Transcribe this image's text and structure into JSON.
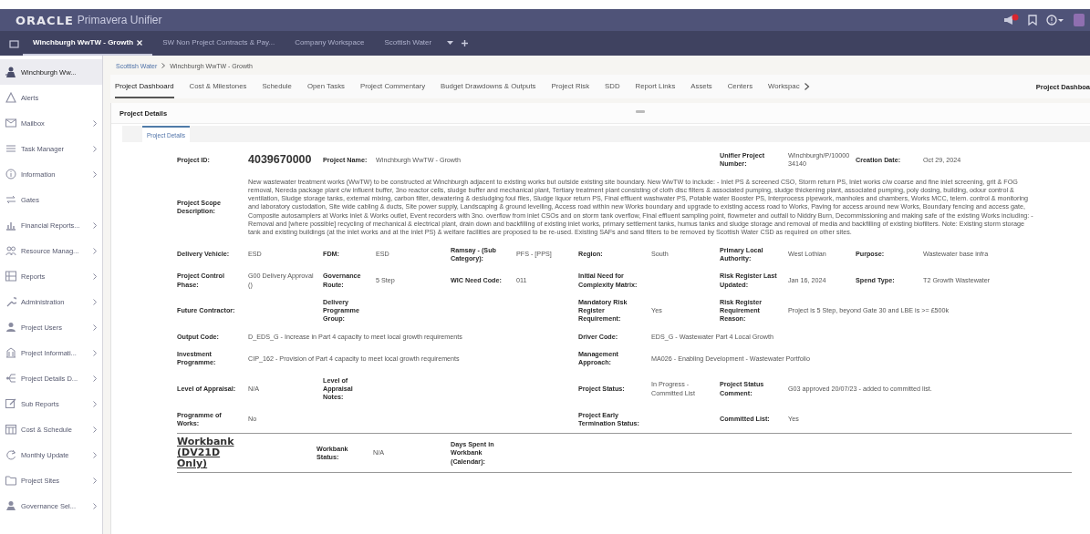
{
  "app": {
    "brand": "ORACLE",
    "product": "Primavera Unifier"
  },
  "top_tabs": [
    {
      "label": "Winchburgh WwTW - Growth",
      "selected": true,
      "closable": true
    },
    {
      "label": "SW Non Project Contracts & Pay...",
      "selected": false,
      "closable": false
    },
    {
      "label": "Company Workspace",
      "selected": false,
      "closable": false
    },
    {
      "label": "Scottish Water",
      "selected": false,
      "closable": false
    }
  ],
  "sidebar": {
    "items": [
      {
        "label": "Winchburgh Ww...",
        "selected": true,
        "has_submenu": false
      },
      {
        "label": "Alerts",
        "selected": false,
        "has_submenu": false
      },
      {
        "label": "Mailbox",
        "selected": false,
        "has_submenu": true
      },
      {
        "label": "Task Manager",
        "selected": false,
        "has_submenu": true
      },
      {
        "label": "Information",
        "selected": false,
        "has_submenu": true
      },
      {
        "label": "Gates",
        "selected": false,
        "has_submenu": false
      },
      {
        "label": "Financial Reports...",
        "selected": false,
        "has_submenu": true
      },
      {
        "label": "Resource Manag...",
        "selected": false,
        "has_submenu": true
      },
      {
        "label": "Reports",
        "selected": false,
        "has_submenu": true
      },
      {
        "label": "Administration",
        "selected": false,
        "has_submenu": true
      },
      {
        "label": "Project Users",
        "selected": false,
        "has_submenu": true
      },
      {
        "label": "Project Informati...",
        "selected": false,
        "has_submenu": true
      },
      {
        "label": "Project Details D...",
        "selected": false,
        "has_submenu": true
      },
      {
        "label": "Sub Reports",
        "selected": false,
        "has_submenu": true
      },
      {
        "label": "Cost & Schedule",
        "selected": false,
        "has_submenu": true
      },
      {
        "label": "Monthly Update",
        "selected": false,
        "has_submenu": true
      },
      {
        "label": "Project Sites",
        "selected": false,
        "has_submenu": true
      },
      {
        "label": "Governance Sel...",
        "selected": false,
        "has_submenu": true
      }
    ]
  },
  "breadcrumb": [
    "Scottish Water",
    "Winchburgh WwTW - Growth"
  ],
  "dashboard_tabs": [
    {
      "label": "Project Dashboard",
      "selected": true
    },
    {
      "label": "Cost & Milestones",
      "selected": false
    },
    {
      "label": "Schedule",
      "selected": false
    },
    {
      "label": "Open Tasks",
      "selected": false
    },
    {
      "label": "Project Commentary",
      "selected": false
    },
    {
      "label": "Budget Drawdowns & Outputs",
      "selected": false
    },
    {
      "label": "Project Risk",
      "selected": false
    },
    {
      "label": "SDD",
      "selected": false
    },
    {
      "label": "Report Links",
      "selected": false
    },
    {
      "label": "Assets",
      "selected": false
    },
    {
      "label": "Centers",
      "selected": false
    },
    {
      "label": "Workspac",
      "selected": false
    }
  ],
  "dashboard_title": "Project Dashboa",
  "panel": {
    "title": "Project Details",
    "tabs": [
      {
        "label": "Project Details",
        "selected": true
      }
    ],
    "rows": [
      {
        "fields": [
          {
            "label": "Project ID:",
            "value": "4039670000",
            "kind": "id"
          },
          {
            "label": "Project Name:",
            "value": "Winchburgh WwTW - Growth"
          },
          {
            "label": "Unifier Project Number:",
            "value": "Winchburgh/P/1000034140"
          },
          {
            "label": "Creation Date:",
            "value": "Oct 29, 2024"
          }
        ]
      },
      {
        "fields": [
          {
            "label": "Project Scope Description:",
            "value": "New wastewater treatment works (WwTW) to be constructed at Winchburgh adjacent to existing works but outside existing site boundary. New WwTW to include: - Inlet PS & screened CSO, Storm return PS, Inlet works c/w coarse and fine inlet screening, grit & FOG removal, Nereda package plant c/w influent buffer, 3no reactor cells, sludge buffer and mechanical plant, Tertiary treatment plant consisting of cloth disc filters & associated pumping, sludge thickening plant, associated pumping, poly dosing, building, odour control & ventilation, Sludge storage tanks, external mixing, carbon filter, dewatering & desludging foul files, Sludge liquor return PS, Final effluent washwater PS, Potable water Booster PS, Interprocess pipework, manholes and chambers, Works MCC, telem. control & monitoring and laboratory custodation, Site wide cabling & ducts, Site power supply, Landscaping & ground levelling, Access road within new Works boundary and upgrade to existing access road to Works, Paving for access around new Works, Boundary fencing and access gate, Composite autosamplers at Works inlet & Works outlet, Event recorders with 3no. overflow from inlet CSOs and on storm tank overflow, Final effluent sampling point, flowmeter and outfall to Niddry Burn, Decommissioning and making safe of the existing Works including: - Removal and [where possible] recycling of mechanical & electrical plant, drain down and backfilling of existing inlet works, primary settlement tanks, humus tanks and sludge storage and removal of media and backfilling of existing biofilters. Note: Existing storm storage tank and existing buildings (at the inlet works and at the inlet PS) & welfare facilities are proposed to be re-used. Existing SAFs and sand filters to be removed by Scottish Water CSD as required on other sites."
          }
        ]
      },
      {
        "fields": [
          {
            "label": "Delivery Vehicle:",
            "value": "ESD"
          },
          {
            "label": "FDM:",
            "value": "ESD"
          },
          {
            "label": "Ramsay - (Sub Category):",
            "value": "PFS - [PPS]"
          },
          {
            "label": "Region:",
            "value": "South"
          },
          {
            "label": "Primary Local Authority:",
            "value": "West Lothian"
          },
          {
            "label": "Purpose:",
            "value": "Wastewater base infra"
          }
        ]
      },
      {
        "fields": [
          {
            "label": "Project Control Phase:",
            "value": "G00 Delivery Approval ()"
          },
          {
            "label": "Governance Route:",
            "value": "5 Step"
          },
          {
            "label": "WIC Need Code:",
            "value": "011"
          },
          {
            "label": "Initial Need for Complexity Matrix:"
          },
          {
            "label": "Risk Register Last Updated:",
            "value": "Jan 16, 2024"
          },
          {
            "label": "Spend Type:",
            "value": "T2 Growth Wastewater"
          }
        ]
      },
      {
        "fields": [
          {
            "label": "Future Contractor:"
          },
          {
            "label": "Delivery Programme Group:"
          },
          {
            "label": "Mandatory Risk Register Requirement:",
            "value": "Yes"
          },
          {
            "label": "Risk Register Requirement Reason:",
            "value": "Project is 5 Step, beyond Gate 30 and LBE is >= £500k"
          }
        ]
      },
      {
        "fields": [
          {
            "label": "Output Code:",
            "value": "D_EDS_G - Increase in Part 4 capacity to meet local growth requirements"
          },
          {
            "label": "Driver Code:",
            "value": "EDS_G - Wastewater Part 4 Local Growth"
          }
        ]
      },
      {
        "fields": [
          {
            "label": "Investment Programme:",
            "value": "CIP_162 - Provision of Part 4 capacity to meet local growth requirements"
          },
          {
            "label": "Management Approach:",
            "value": "MA026 - Enabling Development - Wastewater Portfolio"
          }
        ]
      },
      {
        "fields": [
          {
            "label": "Level of Appraisal:",
            "value": "N/A"
          },
          {
            "label": "Level of Appraisal Notes:"
          },
          {
            "label": "Project Status:",
            "value": "In Progress - Committed List"
          },
          {
            "label": "Project Status Comment:",
            "value": "G03 approved 20/07/23 - added to committed list."
          }
        ]
      },
      {
        "fields": [
          {
            "label": "Programme of Works:",
            "value": "No"
          },
          {
            "label": "Project Early Termination Status:"
          },
          {
            "label": "Committed List:",
            "value": "Yes"
          }
        ]
      }
    ],
    "workbank": {
      "title": "Workbank (DV21D Only)",
      "fields": [
        {
          "label": "Workbank Status:",
          "value": "N/A"
        },
        {
          "label": "Days Spent in Workbank (Calendar):"
        }
      ]
    }
  }
}
